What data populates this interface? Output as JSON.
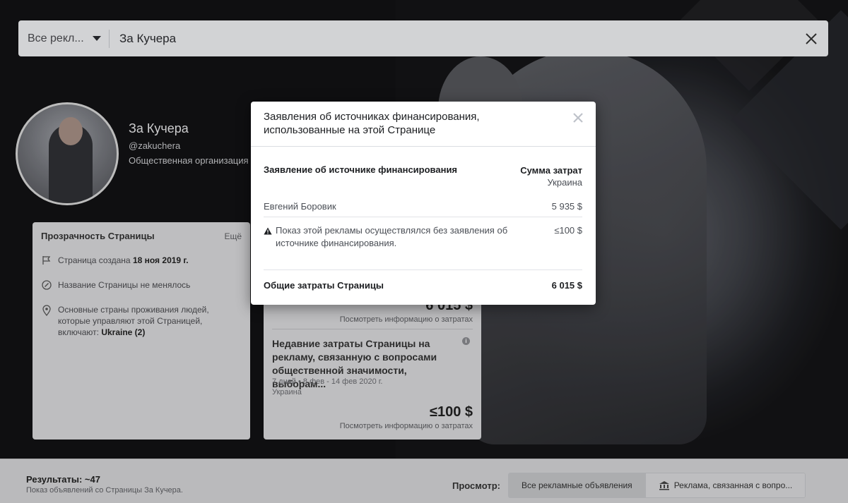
{
  "search": {
    "scope_label": "Все рекл...",
    "query": "За Кучера"
  },
  "profile": {
    "name": "За Кучера",
    "handle": "@zakuchera",
    "category": "Общественная организация"
  },
  "transparency": {
    "title": "Прозрачность Страницы",
    "more_label": "Ещё",
    "created_prefix": "Страница создана ",
    "created_date": "18 ноя 2019 г.",
    "name_unchanged": "Название Страницы не менялось",
    "countries_text": "Основные страны проживания людей, которые управляют этой Страницей, включают: ",
    "countries_value": "Ukraine (2)"
  },
  "spend_card": {
    "total_amount": "6 015 $",
    "view_spend_link": "Посмотреть информацию о затратах",
    "recent_heading": "Недавние затраты Страницы на рекламу, связанную с вопросами общественной значимости, выборам...",
    "period": "7 дней • 8 фев - 14 фев 2020 г.",
    "country": "Украина",
    "recent_amount": "≤100 $",
    "view_spend_link_2": "Посмотреть информацию о затратах"
  },
  "footer": {
    "results_title": "Результаты: ~47",
    "results_sub": "Показ объявлений со Страницы За Кучера.",
    "view_label": "Просмотр:",
    "options": [
      {
        "label": "Все рекламные объявления",
        "active": true
      },
      {
        "label": "Реклама, связанная с вопро...",
        "active": false,
        "icon": "bank-icon"
      }
    ]
  },
  "modal": {
    "title": "Заявления об источниках финансирования, использованные на этой Странице",
    "col_left": "Заявление об источнике финансирования",
    "col_right": "Сумма затрат",
    "col_right_sub": "Украина",
    "rows": [
      {
        "label": "Евгений Боровик",
        "amount": "5 935 $"
      },
      {
        "label": "Показ этой рекламы осуществлялся без заявления об источнике финансирования.",
        "amount": "≤100 $",
        "icon": "warning-icon"
      }
    ],
    "total_label": "Общие затраты Страницы",
    "total_amount": "6 015 $"
  },
  "colors": {
    "modal_bg": "#ffffff",
    "dim_overlay": "#000000",
    "text_primary": "#1c1e21"
  }
}
